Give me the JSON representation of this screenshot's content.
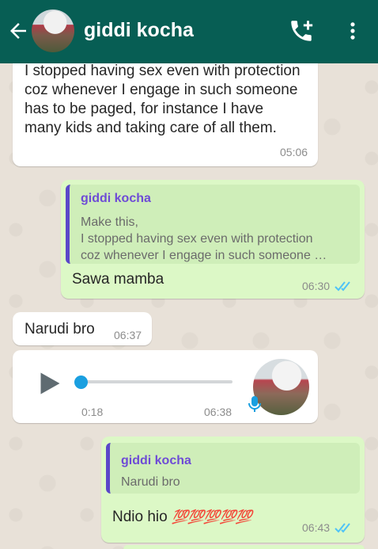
{
  "header": {
    "contact_name": "giddi kocha",
    "back_icon": "arrow-left-icon",
    "call_icon": "phone-add-icon",
    "menu_icon": "more-vertical-icon",
    "color": "#075e54"
  },
  "messages": [
    {
      "direction": "in",
      "text": "I stopped having sex even with protection coz whenever I engage in such someone has to be paged, for instance I have  many kids and taking care of all them.",
      "time": "05:06"
    },
    {
      "direction": "out",
      "quote": {
        "name": "giddi kocha",
        "line1": "Make this,",
        "line2": "I stopped having sex even with protection",
        "line3": "coz whenever I engage in such someone …"
      },
      "text": "Sawa mamba",
      "time": "06:30",
      "status": "read"
    },
    {
      "direction": "in",
      "text": "Narudi bro",
      "time": "06:37"
    },
    {
      "direction": "in",
      "type": "voice",
      "duration": "0:18",
      "time": "06:38",
      "progress": 0
    },
    {
      "direction": "out",
      "quote": {
        "name": "giddi kocha",
        "line1": "Narudi bro"
      },
      "text": "Ndio hio",
      "emoji": "💯💯💯💯💯",
      "time": "06:43",
      "status": "read"
    }
  ],
  "colors": {
    "incoming": "#ffffff",
    "outgoing": "#dcf8c6",
    "read_ticks": "#4fc3f7",
    "quote_bar": "#5a47c9"
  }
}
